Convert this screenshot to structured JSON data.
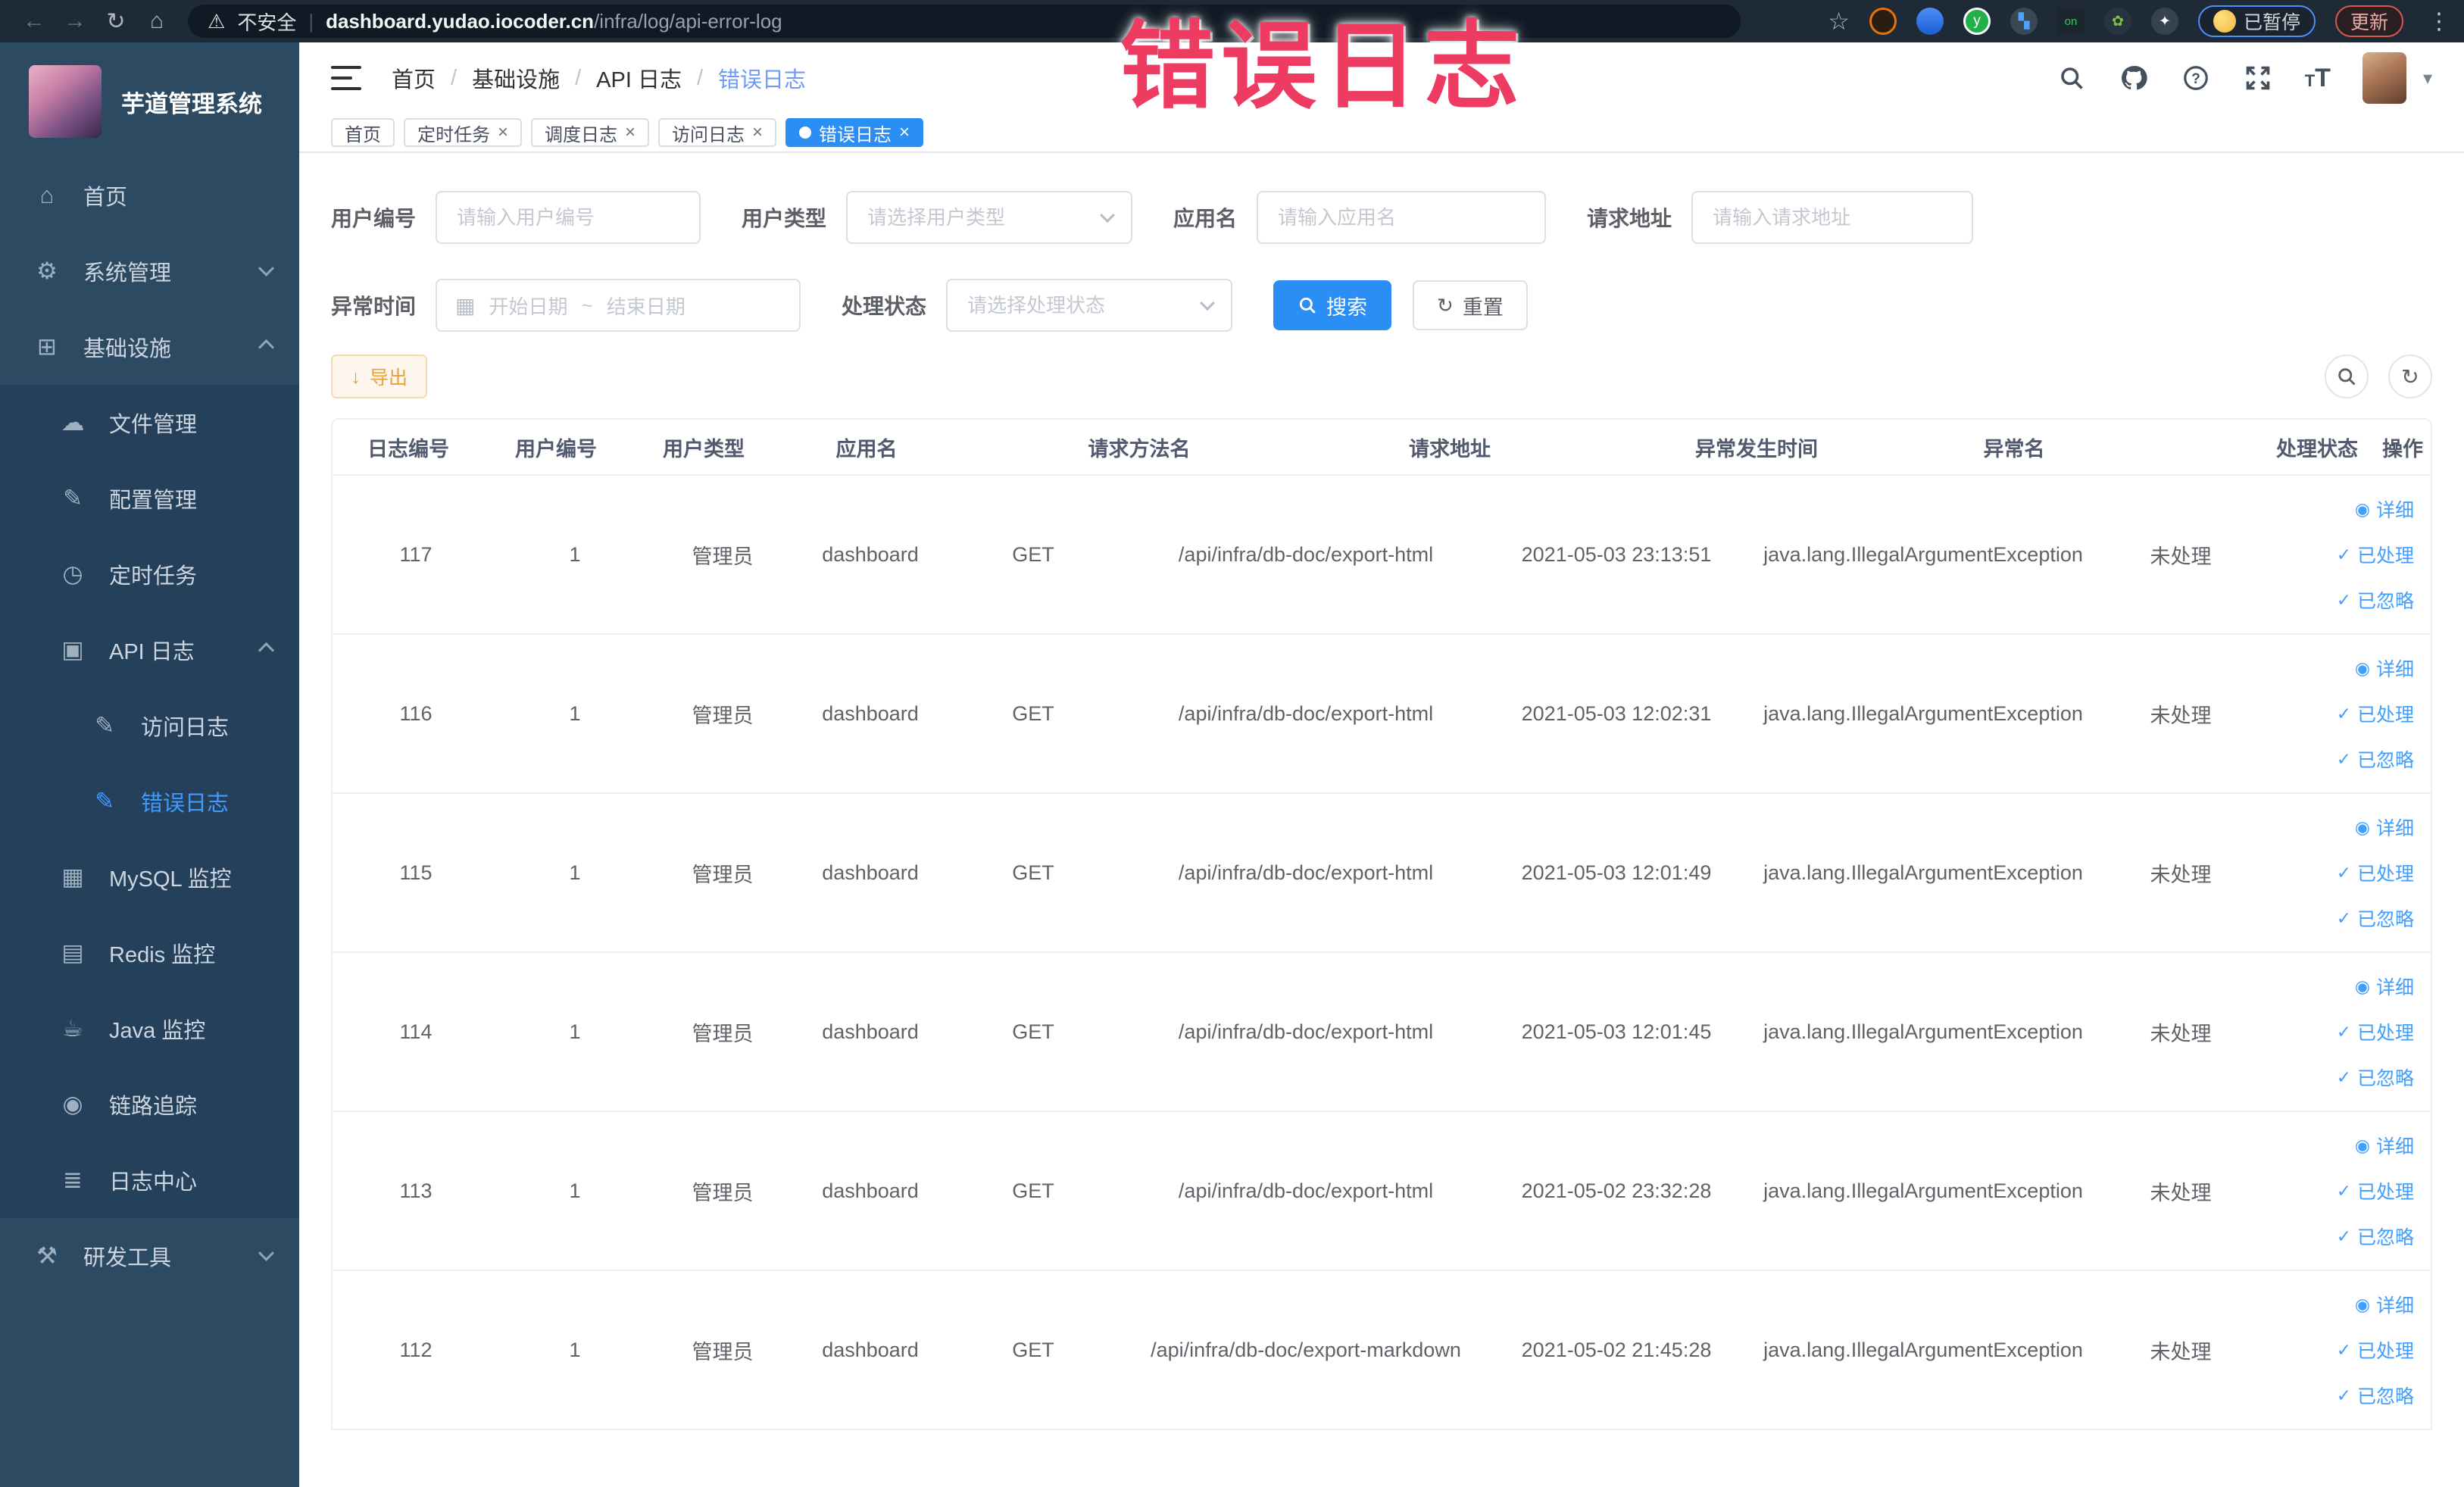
{
  "colors": {
    "primary": "#2b8ef5",
    "link": "#409eff",
    "warning": "#e6a23c",
    "annotation_pink": "#ee3b61",
    "sidebar_bg": "#2d4a63",
    "sidebar_submenu_bg": "#24405a",
    "active_menu": "#3f9bff"
  },
  "annotation": {
    "text": "错误日志"
  },
  "browser": {
    "insecure_label": "不安全",
    "url_host": "dashboard.yudao.iocoder.cn",
    "url_path": "/infra/log/api-error-log",
    "paused_badge": "已暂停",
    "update_button": "更新"
  },
  "icons": {
    "back": "←",
    "forward": "→",
    "reload": "↻",
    "home_nav": "⌂",
    "warning": "⚠",
    "star": "☆",
    "menu_dots": "⋮",
    "home": "⌂",
    "gear": "⚙",
    "infra": "⊞",
    "file": "☁",
    "config": "✎",
    "job": "◷",
    "api_log": "▣",
    "access_log": "✎",
    "error_log": "✎",
    "mysql": "▦",
    "redis": "▤",
    "java": "☕",
    "trace": "◉",
    "log_center": "≣",
    "devtool": "⚒",
    "close": "×",
    "active_dot": "●",
    "calendar": "▦",
    "download": "↓",
    "refresh": "↻",
    "reset": "↻",
    "eye": "◉",
    "check": "✓",
    "caret_down": "▾",
    "ext_on_badge": "on"
  },
  "sidebar": {
    "logo_title": "芋道管理系统",
    "home": "首页",
    "system": "系统管理",
    "infra": "基础设施",
    "file": "文件管理",
    "config": "配置管理",
    "job": "定时任务",
    "api_log": "API 日志",
    "access_log": "访问日志",
    "error_log": "错误日志",
    "mysql": "MySQL 监控",
    "redis": "Redis 监控",
    "java": "Java 监控",
    "trace": "链路追踪",
    "log_center": "日志中心",
    "devtool": "研发工具"
  },
  "header": {
    "breadcrumb": [
      "首页",
      "基础设施",
      "API 日志",
      "错误日志"
    ],
    "separator": "/"
  },
  "tags": [
    {
      "label": "首页"
    },
    {
      "label": "定时任务"
    },
    {
      "label": "调度日志"
    },
    {
      "label": "访问日志"
    },
    {
      "label": "错误日志"
    }
  ],
  "filters": {
    "user_id": {
      "label": "用户编号",
      "placeholder": "请输入用户编号"
    },
    "user_type": {
      "label": "用户类型",
      "placeholder": "请选择用户类型"
    },
    "app_name": {
      "label": "应用名",
      "placeholder": "请输入应用名"
    },
    "request_url": {
      "label": "请求地址",
      "placeholder": "请输入请求地址"
    },
    "exception_time": {
      "label": "异常时间",
      "start_placeholder": "开始日期",
      "separator": "~",
      "end_placeholder": "结束日期"
    },
    "process_status": {
      "label": "处理状态",
      "placeholder": "请选择处理状态"
    },
    "search_label": "搜索",
    "reset_label": "重置"
  },
  "toolbar": {
    "export_label": "导出"
  },
  "table": {
    "columns": [
      "日志编号",
      "用户编号",
      "用户类型",
      "应用名",
      "请求方法名",
      "请求地址",
      "异常发生时间",
      "异常名",
      "处理状态",
      "操作"
    ],
    "row_actions": {
      "detail": "详细",
      "processed": "已处理",
      "ignored": "已忽略"
    },
    "rows": [
      {
        "id": "117",
        "user_id": "1",
        "user_type": "管理员",
        "app": "dashboard",
        "method": "GET",
        "url": "/api/infra/db-doc/export-html",
        "time": "2021-05-03 23:13:51",
        "exception": "java.lang.IllegalArgumentException",
        "status": "未处理"
      },
      {
        "id": "116",
        "user_id": "1",
        "user_type": "管理员",
        "app": "dashboard",
        "method": "GET",
        "url": "/api/infra/db-doc/export-html",
        "time": "2021-05-03 12:02:31",
        "exception": "java.lang.IllegalArgumentException",
        "status": "未处理"
      },
      {
        "id": "115",
        "user_id": "1",
        "user_type": "管理员",
        "app": "dashboard",
        "method": "GET",
        "url": "/api/infra/db-doc/export-html",
        "time": "2021-05-03 12:01:49",
        "exception": "java.lang.IllegalArgumentException",
        "status": "未处理"
      },
      {
        "id": "114",
        "user_id": "1",
        "user_type": "管理员",
        "app": "dashboard",
        "method": "GET",
        "url": "/api/infra/db-doc/export-html",
        "time": "2021-05-03 12:01:45",
        "exception": "java.lang.IllegalArgumentException",
        "status": "未处理"
      },
      {
        "id": "113",
        "user_id": "1",
        "user_type": "管理员",
        "app": "dashboard",
        "method": "GET",
        "url": "/api/infra/db-doc/export-html",
        "time": "2021-05-02 23:32:28",
        "exception": "java.lang.IllegalArgumentException",
        "status": "未处理"
      },
      {
        "id": "112",
        "user_id": "1",
        "user_type": "管理员",
        "app": "dashboard",
        "method": "GET",
        "url": "/api/infra/db-doc/export-markdown",
        "time": "2021-05-02 21:45:28",
        "exception": "java.lang.IllegalArgumentException",
        "status": "未处理"
      }
    ]
  }
}
